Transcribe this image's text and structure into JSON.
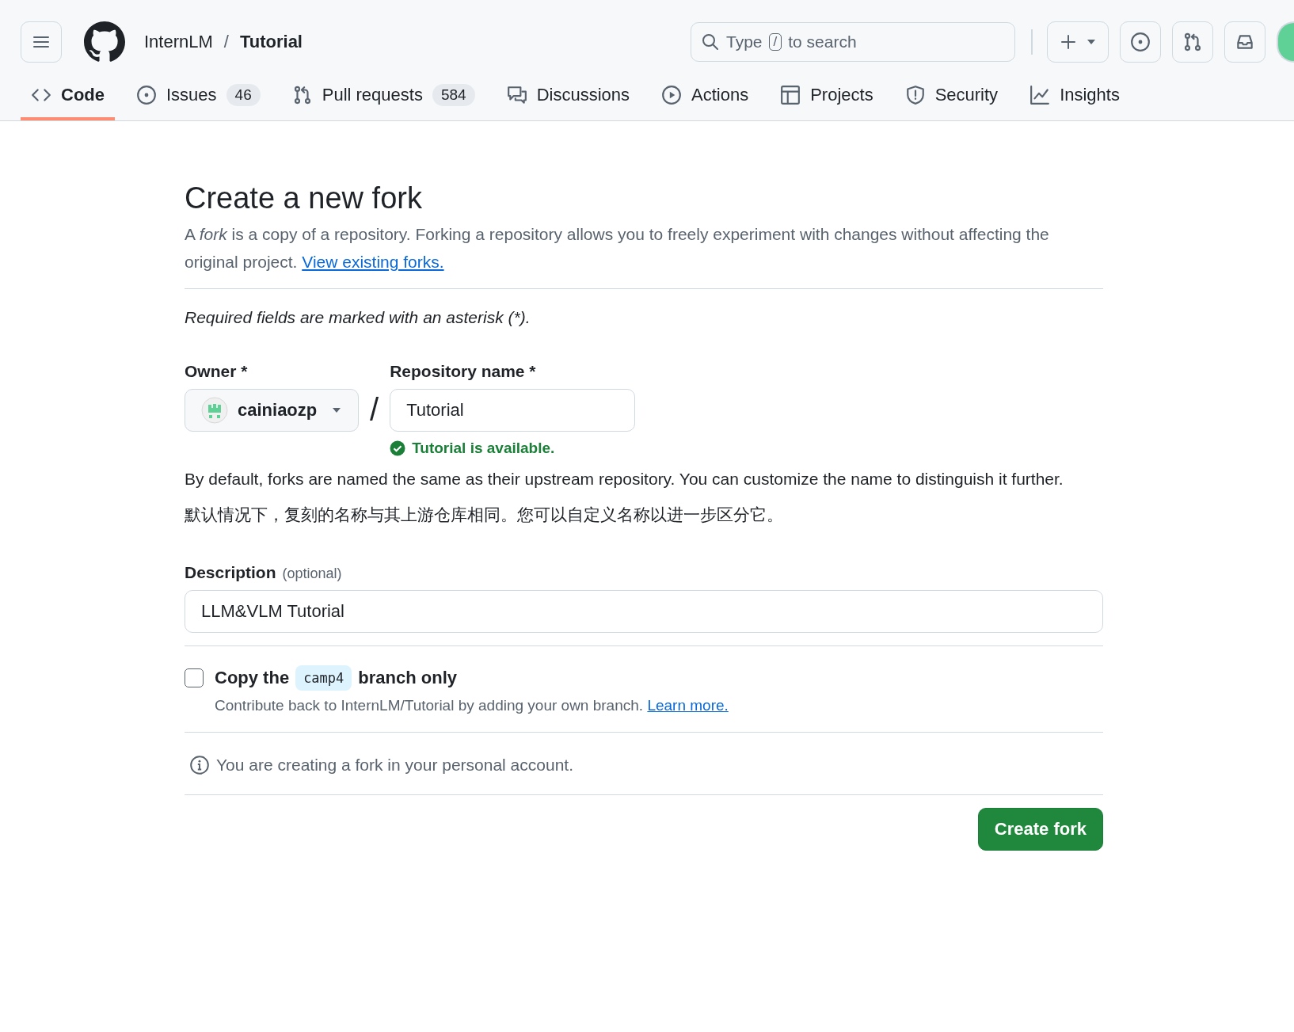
{
  "header": {
    "owner": "InternLM",
    "separator": "/",
    "repo": "Tutorial",
    "search": {
      "before": "Type",
      "key": "/",
      "after": "to search"
    }
  },
  "tabs": [
    {
      "label": "Code",
      "selected": true
    },
    {
      "label": "Issues",
      "counter": "46",
      "selected": false
    },
    {
      "label": "Pull requests",
      "counter": "584",
      "selected": false
    },
    {
      "label": "Discussions",
      "selected": false
    },
    {
      "label": "Actions",
      "selected": false
    },
    {
      "label": "Projects",
      "selected": false
    },
    {
      "label": "Security",
      "selected": false
    },
    {
      "label": "Insights",
      "selected": false
    }
  ],
  "form": {
    "title": "Create a new fork",
    "intro": "A *fork* is a copy of a repository. Forking a repository allows you to freely experiment with changes without affecting the original project.",
    "intro_link": "View existing forks.",
    "required_note": "Required fields are marked with an asterisk (*).",
    "owner": {
      "label": "Owner *",
      "value": "cainiaozp"
    },
    "slash": "/",
    "repo_name": {
      "label": "Repository name *",
      "value": "Tutorial",
      "status": "Tutorial is available."
    },
    "default_note": "By default, forks are named the same as their upstream repository. You can customize the name to distinguish it further.",
    "default_note_zh": "默认情况下，复刻的名称与其上游仓库相同。您可以自定义名称以进一步区分它。",
    "description": {
      "label": "Description",
      "hint": "(optional)",
      "value": "LLM&VLM Tutorial"
    },
    "copy_branch": {
      "checked": false,
      "before": "Copy the",
      "branch": "camp4",
      "after": "branch only",
      "help": "Contribute back to InternLM/Tutorial by adding your own branch.",
      "help_link": "Learn more."
    },
    "account_note": "You are creating a fork in your personal account.",
    "submit": "Create fork"
  }
}
